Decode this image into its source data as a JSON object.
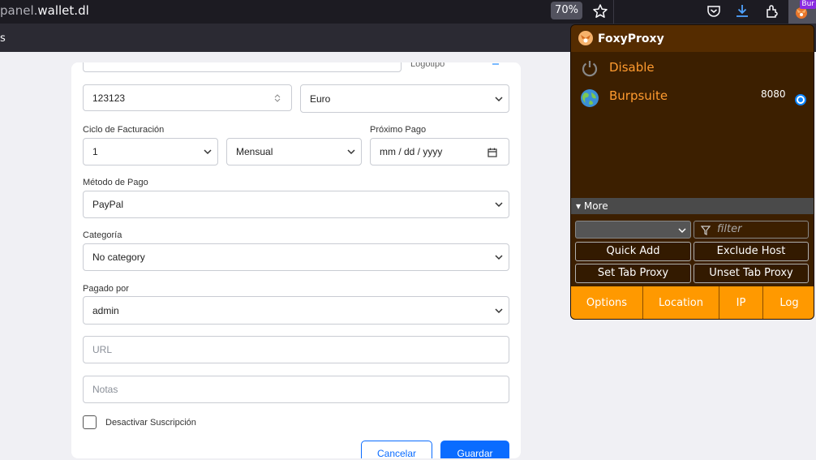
{
  "browser": {
    "url_domain": "panel.",
    "url_host": "wallet.dl",
    "zoom": "70%",
    "tab_fragment": "s",
    "profile_badge": "Bur"
  },
  "form": {
    "logo_label": "Logotipo",
    "price_value": "123123",
    "currency_value": "Euro",
    "billing_cycle_label": "Ciclo de Facturación",
    "billing_cycle_value": "1",
    "billing_frequency_value": "Mensual",
    "next_payment_label": "Próximo Pago",
    "next_payment_placeholder": "mm / dd / yyyy",
    "payment_method_label": "Método de Pago",
    "payment_method_value": "PayPal",
    "category_label": "Categoría",
    "category_value": "No category",
    "paid_by_label": "Pagado por",
    "paid_by_value": "admin",
    "url_placeholder": "URL",
    "notes_placeholder": "Notas",
    "disable_label": "Desactivar Suscripción",
    "cancel_label": "Cancelar",
    "save_label": "Guardar"
  },
  "foxyproxy": {
    "title": "FoxyProxy",
    "disable_label": "Disable",
    "proxy_name": "Burpsuite",
    "proxy_port": "8080",
    "more_label": "More",
    "filter_placeholder": "filter",
    "quick_add": "Quick Add",
    "exclude_host": "Exclude Host",
    "set_tab_proxy": "Set Tab Proxy",
    "unset_tab_proxy": "Unset Tab Proxy",
    "footer": [
      "Options",
      "Location",
      "IP",
      "Log"
    ]
  },
  "colors": {
    "primary": "#0a6cff",
    "foxy_bg": "#3c1f00",
    "foxy_accent": "#ff9900",
    "foxy_text": "#ff9b2f"
  },
  "icons": [
    "star-icon",
    "pocket-icon",
    "download-icon",
    "extensions-icon",
    "foxyproxy-icon",
    "power-icon",
    "globe-icon",
    "filter-icon",
    "calendar-icon",
    "chevron-down-icon"
  ]
}
